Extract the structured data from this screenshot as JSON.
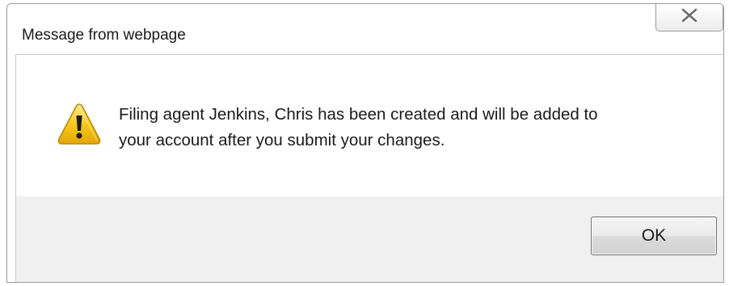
{
  "dialog": {
    "title": "Message from webpage",
    "close_icon": "close-x-icon",
    "icon": "warning-icon",
    "message_line1": "Filing agent Jenkins, Chris has been created and will be added to",
    "message_line2": "your account after you submit your changes.",
    "ok_label": "OK"
  },
  "colors": {
    "content_bg": "#ffffff",
    "footer_bg": "#f0f0f0",
    "warning_yellow": "#f5c518"
  }
}
